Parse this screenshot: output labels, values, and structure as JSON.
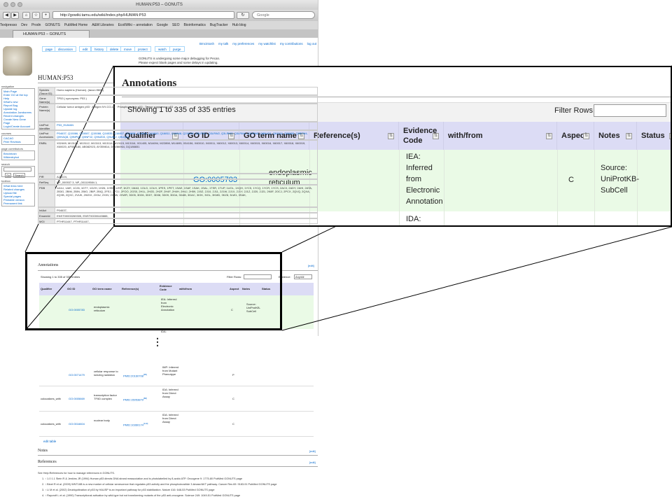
{
  "browser": {
    "window_title": "HUMAN:P53 – GONUTS",
    "url": "http://gowiki.tamu.edu/wiki/index.php/HUMAN:P53",
    "search_placeholder": "Google",
    "tab_title": "HUMAN:P53 – GONUTS",
    "bookmarks": [
      "Textpresso",
      "Dev",
      "Prodn",
      "GONUTS",
      "PubMed Home",
      "A&M Libraries",
      "EcoliWiki – annotation",
      "Google",
      "SEO",
      "Bioinformatics",
      "BugTracker",
      "Hub blog"
    ]
  },
  "wiki": {
    "tabs": [
      "page",
      "discussion",
      "edit",
      "history",
      "delete",
      "move",
      "protect",
      "watch",
      "purge"
    ],
    "personal": [
      "Bmcintosh",
      "my talk",
      "my preferences",
      "my watchlist",
      "my contributions",
      "log out"
    ],
    "notice_1": "GONUTS is undergoing some major debugging for Pecan.",
    "notice_2": "Please expect blank pages and some delays in updating.",
    "page_title": "HUMAN:P53",
    "sidebar": {
      "nav_heading": "navigation",
      "nav": [
        "Main Page",
        "Enter GO at the top",
        "Help",
        "What's new",
        "Report Bug",
        "Update log",
        "Annotation Jamborees",
        "Recent changes",
        "Create New Gene Page",
        "Login/Create Account"
      ],
      "courses_heading": "courses",
      "courses": [
        "CACAO",
        "Peer Reviews"
      ],
      "contrib_heading": "page contributors",
      "contrib": [
        "Bmcintosh",
        "Wikientrybot"
      ],
      "search_heading": "search",
      "search_go": "Go",
      "search_search": "Search",
      "toolbox_heading": "toolbox",
      "toolbox": [
        "What links here",
        "Related changes",
        "Upload file",
        "Special pages",
        "Printable version",
        "Permanent link"
      ]
    },
    "infobox": [
      {
        "label": "Species (Taxon ID)",
        "value": "Homo sapiens (Human). (taxon:9606)"
      },
      {
        "label": "Gene Name(s)",
        "value": "TP53 ( synonyms: P53 )"
      },
      {
        "label": "Protein Name(s)",
        "value": "Cellular tumor antigen p53 · Antigen NY-CO-13 · Phosphoprotein p53 · Tumor suppressor p53"
      },
      {
        "label": "UniProt Identifier",
        "value": "P53_HUMAN"
      },
      {
        "label": "UniProt Accessions",
        "value": "P04637, Q15086, Q15087, Q15088, Q16535, Q16807, Q16808, Q16809, Q16810, Q16811, Q16848, Q2XN98, Q3LRW1, Q3LRW2, Q3LRW3, Q3LRW4, Q3LRW5, Q86UG1, Q8J016, Q99659, Q9BTM4, Q9HAQ8, Q9NP68, Q9NPJ2, Q9NZD0, Q9UBI2, Q9UQ61"
      },
      {
        "label": "EMBL",
        "value": "X02469, M13121, M13112, M13113, M13114, M13115, M13116, X01405, M14694, M22898, M14695, X54156, X60010, X60011, X60012, X60013, X60014, X60015, X60016, X60017, X60018, X60019, X60020, AF052180, AB082923, AY359814, DQ286964, DQ186651"
      },
      {
        "label": "PIR",
        "value": "A25224,"
      },
      {
        "label": "RefSeq",
        "value": "NP_000537.3, NP_001119584.1,"
      },
      {
        "label": "PDB",
        "value": "1A1U, 1AIE, 1C26, 1DT7, 1GZH, 1H26, 1HS5, 1JSP, 1KZY, 1MA3, 1OLG, 1OLH, 1PES, 1PET, 1SAE, 1SAF, 1SAK, 1SAL, 1TSR, 1TUP, 1UOL, 1XQH, 1YC5, 1YCQ, 1YCR, 1YCS, 2AC0, 2ADY, 2AHI, 2ATA, 2B3G, 2BIM, 2BIN, 2BIO, 2BIP, 2BIQ, 2FEJ, 2FOJ, 2FOO, 2GS0, 2H1L, 2H2D, 2H2F, 2H4F, 2H4H, 2H4J, 2H59, 2J0Z, 2J10, 2J11, 2J1W, 2J1X, 2J1Y, 2J1Z, 2J20, 2J21, 2K8F, 2OCJ, 2PCX, 2QVQ, 2QXA, 2QXB, 2QXC, 2VUK, 2WGX, 2X0U, 2X0V, 2X0W, 2XWR, 3D05, 3D06, 3D07, 3D08, 3D09, 3D0A, 3DAB, 3DAC, 3IGK, 3IGL, 3KMD, 3KZ8, 3LW1, 3SAK,"
      },
      {
        "label": "IntAct",
        "value": "P04637,"
      },
      {
        "label": "Ensembl",
        "value": "ENST00000269305, ENST00000445888,"
      },
      {
        "label": "MGI",
        "value": "PTHR11447, PTHR11447,"
      }
    ],
    "annotations_title": "Annotations",
    "edit_link": "[edit]",
    "showing": "Showing 1 to 335 of 335 entries",
    "filter_label": "Filter Rows:",
    "evidence_label": "Evidence:",
    "evidence_value": "Any/All"
  },
  "columns": [
    "Qualifier",
    "GO ID",
    "GO term name",
    "Reference(s)",
    "Evidence Code",
    "with/from",
    "Aspect",
    "Notes",
    "Status"
  ],
  "first_row": {
    "qualifier": "",
    "go_id": "GO:0005783",
    "go_term": "endoplasmic reticulum",
    "reference": "",
    "evidence": "IEA: Inferred from Electronic Annotation",
    "with_from": "",
    "aspect": "C",
    "notes": "Source: UniProtKB-SubCell",
    "status": ""
  },
  "second_row_evidence": "IDA:",
  "zoom": {
    "title": "Annotations",
    "showing": "Showing 1 to 335 of 335 entries",
    "filter_label": "Filter Rows:",
    "evidence_lines": [
      "IEA:",
      "Inferred",
      "from",
      "Electronic",
      "Annotation"
    ],
    "go_term_lines": [
      "endoplasmic",
      "reticulum"
    ],
    "notes_lines": [
      "Source:",
      "UniProtKB-",
      "SubCell"
    ]
  },
  "ellipsis": "⋮",
  "lower_rows": [
    {
      "qualifier": "",
      "go_id": "GO:0071479",
      "go_term": "cellular response to ionizing radiation",
      "reference": "PMID:20160708",
      "ref_num": "[95]",
      "evidence": "IMP: Inferred from Mutant Phenotype",
      "aspect": "P"
    },
    {
      "qualifier": "colocalizes_with",
      "go_id": "GO:0005669",
      "go_term": "transcription factor TFIID complex",
      "reference": "PMID:15053879",
      "ref_num": "[88]",
      "evidence": "IDA: Inferred from Direct Assay",
      "aspect": "C"
    },
    {
      "qualifier": "colocalizes_with",
      "go_id": "GO:0016604",
      "go_term": "nuclear body",
      "reference": "PMID:10360174",
      "ref_num": "[110]",
      "evidence": "IDA: Inferred from Direct Assay",
      "aspect": "C"
    }
  ],
  "edit_table": "edit table",
  "notes_title": "Notes",
  "references_title": "References",
  "references_help": "See Help:References for how to manage references in GONUTS.",
  "references": [
    "1. ↑ 1.0 1.1 Stein R & Jenkins JR (1994) Human p53 directs DNA strand reassociation and is photolabelled by 8-azido ATP. Oncogene 9: 1775-80 PubMed GONUTS page",
    "2. ↑ Binet R et al. (2009) WNT16B is a new marker of cellular senescence that regulates p53 activity and the phosphoinositide 3-kinase/AKT pathway. Cancer Res 69: 9183-91 PubMed GONUTS page",
    "3. ↑ Li M et al. (2002) Deubiquitination of p53 by HAUSP is an important pathway for p53 stabilization. Nature 416: 648-53 PubMed GONUTS page",
    "4. ↑ Raycroft L et al. (1990) Transcriptional activation by wild-type but not transforming mutants of the p53 anti-oncogene. Science 249: 1049-51 PubMed GONUTS page"
  ]
}
